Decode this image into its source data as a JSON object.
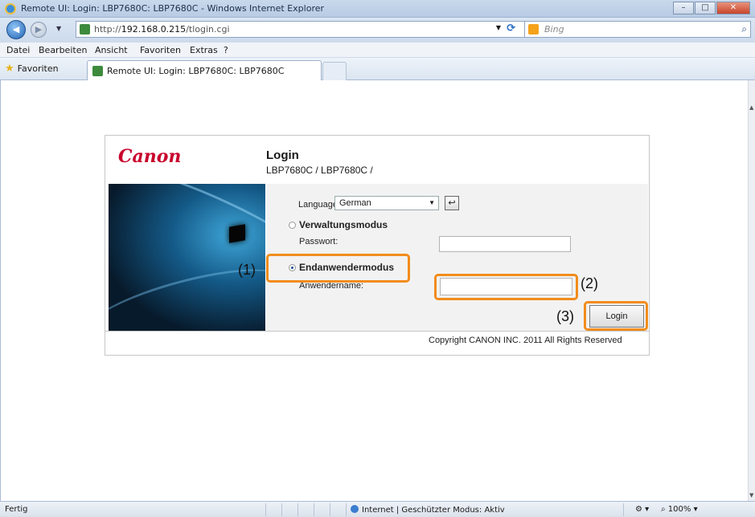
{
  "window": {
    "title": "Remote UI: Login: LBP7680C: LBP7680C - Windows Internet Explorer",
    "min": "–",
    "max": "□",
    "close": "✕"
  },
  "nav": {
    "back": "◀",
    "forward": "▶",
    "url_prefix": "http://",
    "url_host": "192.168.0.215",
    "url_path": "/tlogin.cgi",
    "search_placeholder": "Bing"
  },
  "menu": {
    "items": [
      "Datei",
      "Bearbeiten",
      "Ansicht",
      "Favoriten",
      "Extras",
      "?"
    ]
  },
  "favbar": {
    "favorites_label": "Favoriten",
    "tab_title": "Remote UI: Login: LBP7680C: LBP7680C"
  },
  "page": {
    "logo": "Canon",
    "title": "Login",
    "subtitle": "LBP7680C / LBP7680C /",
    "language_label": "Language:",
    "language_value": "German",
    "admin_mode_label": "Verwaltungsmodus",
    "password_label": "Passwort:",
    "enduser_mode_label": "Endanwendermodus",
    "username_label": "Anwendername:",
    "login_button": "Login",
    "copyright": "Copyright CANON INC. 2011 All Rights Reserved",
    "selected_mode": "Endanwendermodus"
  },
  "callouts": {
    "c1": "(1)",
    "c2": "(2)",
    "c3": "(3)"
  },
  "status": {
    "left": "Fertig",
    "zone": "Internet | Geschützter Modus: Aktiv",
    "zoom": "100%"
  },
  "colors": {
    "highlight": "#f28c1c",
    "canon_red": "#c8002b"
  }
}
